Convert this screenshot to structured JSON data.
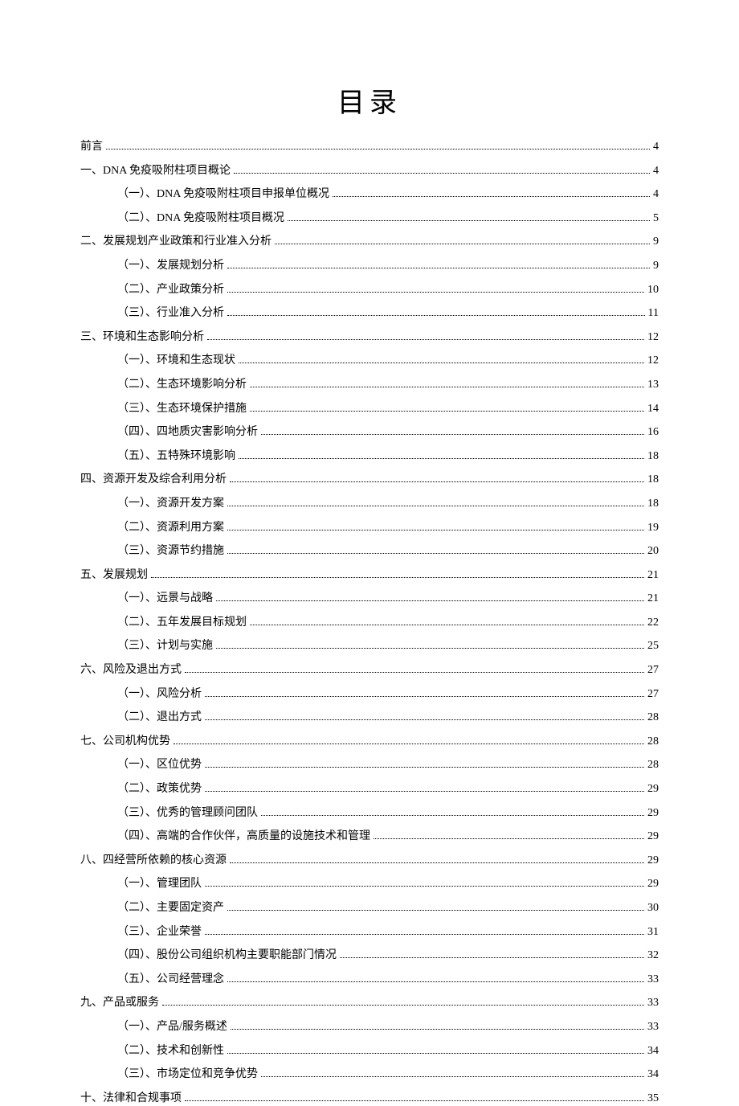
{
  "title": "目录",
  "toc": [
    {
      "level": 1,
      "label": "前言",
      "page": "4"
    },
    {
      "level": 1,
      "label": "一、DNA 免疫吸附柱项目概论",
      "page": "4"
    },
    {
      "level": 2,
      "label": "（一）、DNA 免疫吸附柱项目申报单位概况",
      "page": "4"
    },
    {
      "level": 2,
      "label": "（二）、DNA 免疫吸附柱项目概况",
      "page": "5"
    },
    {
      "level": 1,
      "label": "二、发展规划产业政策和行业准入分析",
      "page": "9"
    },
    {
      "level": 2,
      "label": "（一）、发展规划分析",
      "page": "9"
    },
    {
      "level": 2,
      "label": "（二）、产业政策分析",
      "page": "10"
    },
    {
      "level": 2,
      "label": "（三）、行业准入分析",
      "page": "11"
    },
    {
      "level": 1,
      "label": "三、环境和生态影响分析",
      "page": "12"
    },
    {
      "level": 2,
      "label": "（一）、环境和生态现状",
      "page": "12"
    },
    {
      "level": 2,
      "label": "（二）、生态环境影响分析",
      "page": "13"
    },
    {
      "level": 2,
      "label": "（三）、生态环境保护措施",
      "page": "14"
    },
    {
      "level": 2,
      "label": "（四）、四地质灾害影响分析",
      "page": "16"
    },
    {
      "level": 2,
      "label": "（五）、五特殊环境影响",
      "page": "18"
    },
    {
      "level": 1,
      "label": "四、资源开发及综合利用分析",
      "page": "18"
    },
    {
      "level": 2,
      "label": "（一）、资源开发方案",
      "page": "18"
    },
    {
      "level": 2,
      "label": "（二）、资源利用方案",
      "page": "19"
    },
    {
      "level": 2,
      "label": "（三）、资源节约措施",
      "page": "20"
    },
    {
      "level": 1,
      "label": "五、发展规划",
      "page": "21"
    },
    {
      "level": 2,
      "label": "（一）、远景与战略",
      "page": "21"
    },
    {
      "level": 2,
      "label": "（二）、五年发展目标规划",
      "page": "22"
    },
    {
      "level": 2,
      "label": "（三）、计划与实施",
      "page": "25"
    },
    {
      "level": 1,
      "label": "六、风险及退出方式",
      "page": "27"
    },
    {
      "level": 2,
      "label": "（一）、风险分析",
      "page": "27"
    },
    {
      "level": 2,
      "label": "（二）、退出方式",
      "page": "28"
    },
    {
      "level": 1,
      "label": "七、公司机构优势",
      "page": "28"
    },
    {
      "level": 2,
      "label": "（一）、区位优势",
      "page": "28"
    },
    {
      "level": 2,
      "label": "（二）、政策优势",
      "page": "29"
    },
    {
      "level": 2,
      "label": "（三）、优秀的管理顾问团队",
      "page": "29"
    },
    {
      "level": 2,
      "label": "（四）、高端的合作伙伴，高质量的设施技术和管理",
      "page": "29"
    },
    {
      "level": 1,
      "label": "八、四经营所依赖的核心资源",
      "page": "29"
    },
    {
      "level": 2,
      "label": "（一）、管理团队",
      "page": "29"
    },
    {
      "level": 2,
      "label": "（二）、主要固定资产",
      "page": "30"
    },
    {
      "level": 2,
      "label": "（三）、企业荣誉",
      "page": "31"
    },
    {
      "level": 2,
      "label": "（四）、股份公司组织机构主要职能部门情况",
      "page": "32"
    },
    {
      "level": 2,
      "label": "（五）、公司经营理念",
      "page": "33"
    },
    {
      "level": 1,
      "label": "九、产品或服务",
      "page": "33"
    },
    {
      "level": 2,
      "label": "（一）、产品/服务概述",
      "page": "33"
    },
    {
      "level": 2,
      "label": "（二）、技术和创新性",
      "page": "34"
    },
    {
      "level": 2,
      "label": "（三）、市场定位和竞争优势",
      "page": "34"
    },
    {
      "level": 1,
      "label": "十、法律和合规事项",
      "page": "35"
    }
  ]
}
